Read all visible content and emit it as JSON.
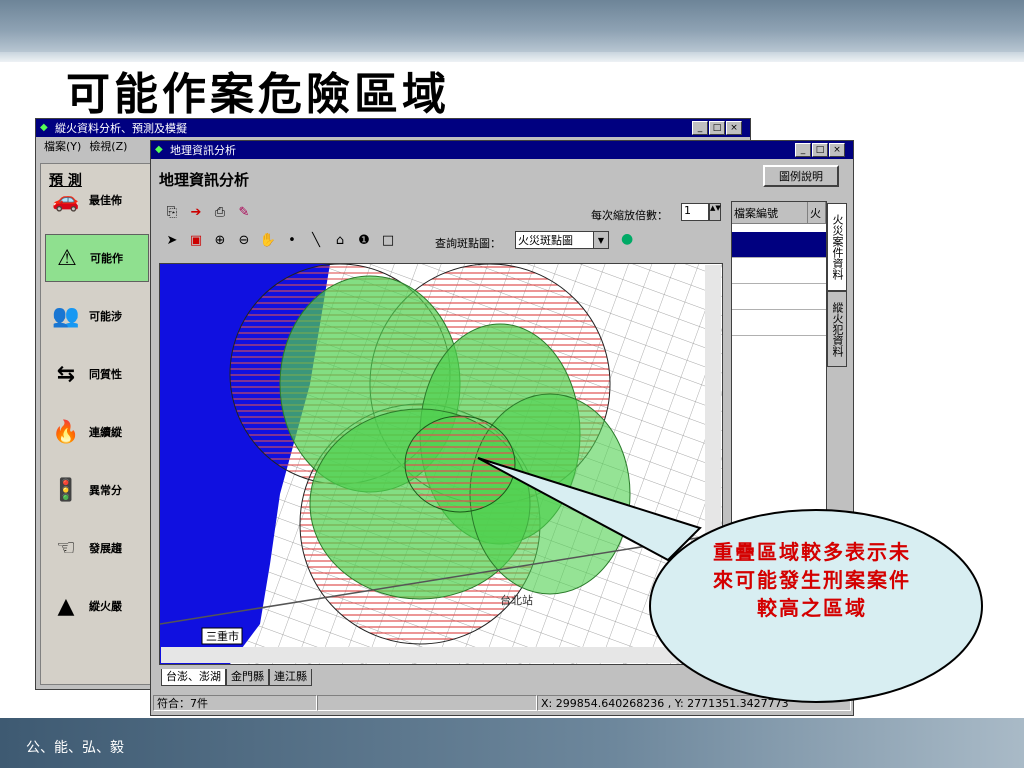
{
  "slide": {
    "title": "可能作案危險區域",
    "footer": "公、能、弘、毅"
  },
  "back_window": {
    "title": "縱火資料分析、預測及模擬",
    "menu": [
      "檔案(Y)",
      "檢視(Z)"
    ],
    "side_tab": "預 測",
    "side_items": [
      {
        "label": "最佳佈",
        "icon": "car-icon",
        "glyph": "🚗"
      },
      {
        "label": "可能作",
        "icon": "warning-icon",
        "glyph": "⚠"
      },
      {
        "label": "可能涉",
        "icon": "people-icon",
        "glyph": "👥"
      },
      {
        "label": "同質性",
        "icon": "arrows-icon",
        "glyph": "⇆"
      },
      {
        "label": "連續縱",
        "icon": "fire-can-icon",
        "glyph": "🔥"
      },
      {
        "label": "異常分",
        "icon": "traffic-light-icon",
        "glyph": "🚦"
      },
      {
        "label": "發展趨",
        "icon": "hand-icon",
        "glyph": "☜"
      },
      {
        "label": "縱火嚴",
        "icon": "cone-icon",
        "glyph": "▲"
      }
    ]
  },
  "front_window": {
    "title": "地理資訊分析",
    "header": "地理資訊分析",
    "legend_button": "圖例說明",
    "zoom_label": "每次縮放倍數：",
    "zoom_value": "1",
    "query_label": "查詢斑點圖：",
    "query_value": "火災斑點圖",
    "map_label_city": "三重市",
    "map_label_station": "台北站",
    "tabs": [
      "台澎、澎湖",
      "金門縣",
      "連江縣"
    ],
    "status_count": "符合：7件",
    "status_coords": "X: 299854.640268236 , Y: 2771351.3427773",
    "table_headers": [
      "檔案編號",
      "火"
    ],
    "vtabs": [
      "火災案件資料",
      "縱火犯資料"
    ]
  },
  "callout": {
    "text": "重疊區域較多表示未來可能發生刑案案件較高之區域"
  },
  "colors": {
    "titlebar": "#000080",
    "water": "#1010e0",
    "green_zone": "#4fd04f",
    "red_hatch": "#e05050",
    "callout_fill": "#d8eef2",
    "callout_text": "#d40000"
  }
}
